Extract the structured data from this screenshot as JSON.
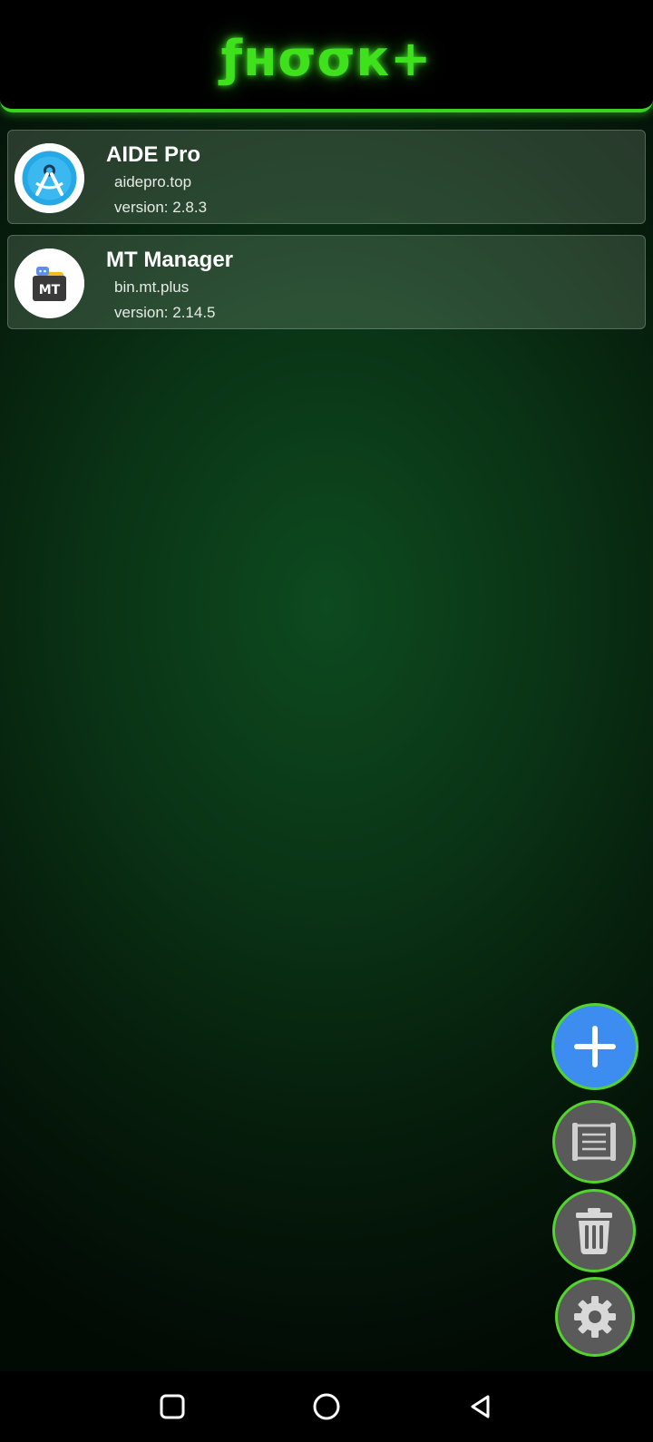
{
  "header": {
    "title": "ƒнσσк+"
  },
  "apps": [
    {
      "name": "AIDE Pro",
      "package": "aidepro.top",
      "version": "version: 2.8.3",
      "icon": "aide-pro-app-icon"
    },
    {
      "name": "MT Manager",
      "package": "bin.mt.plus",
      "version": "version: 2.14.5",
      "icon": "mt-manager-app-icon"
    }
  ],
  "fabs": {
    "add": "plus-icon",
    "log": "scroll-icon",
    "delete": "trash-icon",
    "settings": "gear-icon"
  },
  "navbar": {
    "recents": "square-icon",
    "home": "circle-icon",
    "back": "triangle-back-icon"
  },
  "colors": {
    "accent_green": "#3ee11b",
    "fab_blue": "#3d8df0",
    "fab_gray": "#5a5a5a"
  }
}
